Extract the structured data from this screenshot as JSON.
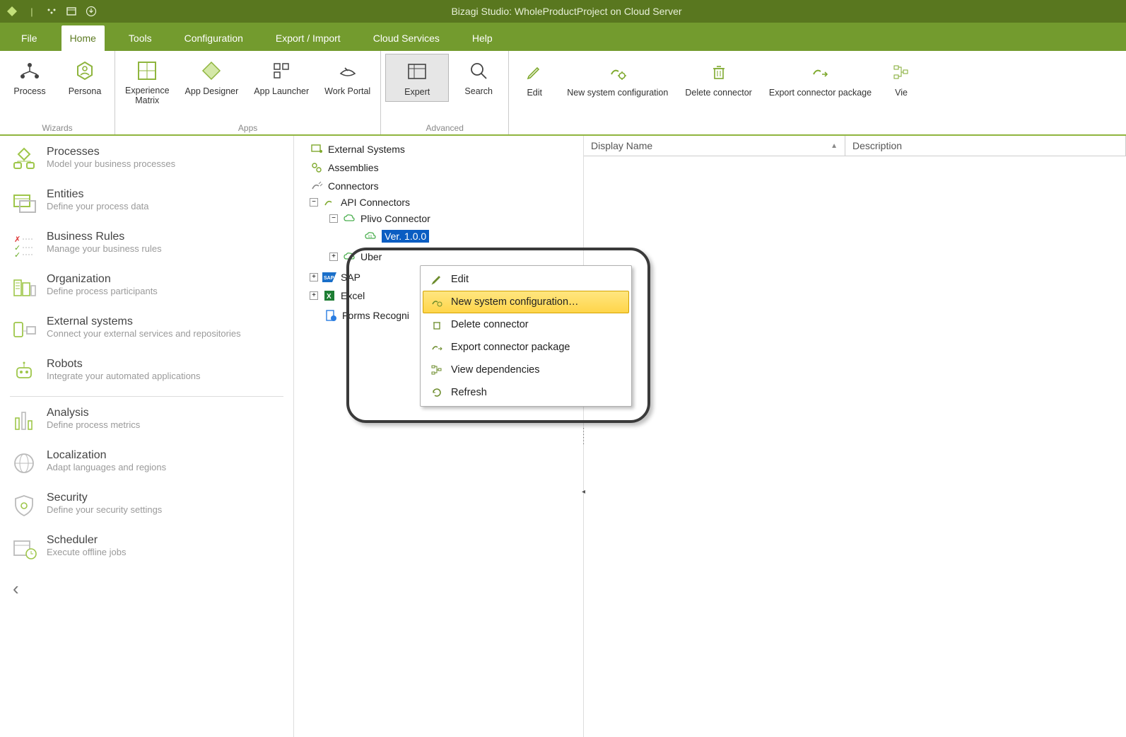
{
  "titlebar": {
    "title": "Bizagi Studio: WholeProductProject  on Cloud Server"
  },
  "tabs": {
    "file": "File",
    "home": "Home",
    "tools": "Tools",
    "configuration": "Configuration",
    "export_import": "Export / Import",
    "cloud_services": "Cloud Services",
    "help": "Help"
  },
  "ribbon": {
    "groups": {
      "wizards": {
        "label": "Wizards",
        "process": "Process",
        "persona": "Persona"
      },
      "apps": {
        "label": "Apps",
        "experience_matrix": "Experience Matrix",
        "app_designer": "App Designer",
        "app_launcher": "App Launcher",
        "work_portal": "Work Portal"
      },
      "advanced": {
        "label": "Advanced",
        "expert": "Expert",
        "search": "Search"
      }
    },
    "right": {
      "edit": "Edit",
      "new_system_configuration": "New system configuration",
      "delete_connector": "Delete connector",
      "export_connector_package": "Export connector package",
      "view_cut": "Vie"
    }
  },
  "sidebar": {
    "items": [
      {
        "title": "Processes",
        "subtitle": "Model your business processes"
      },
      {
        "title": "Entities",
        "subtitle": "Define your process data"
      },
      {
        "title": "Business  Rules",
        "subtitle": "Manage your business rules"
      },
      {
        "title": "Organization",
        "subtitle": "Define process participants"
      },
      {
        "title": "External systems",
        "subtitle": "Connect your external services and repositories"
      },
      {
        "title": "Robots",
        "subtitle": "Integrate your automated applications"
      },
      {
        "title": "Analysis",
        "subtitle": "Define process metrics"
      },
      {
        "title": "Localization",
        "subtitle": "Adapt languages and regions"
      },
      {
        "title": "Security",
        "subtitle": "Define your security settings"
      },
      {
        "title": "Scheduler",
        "subtitle": "Execute offline jobs"
      }
    ]
  },
  "tree": {
    "external_systems": "External Systems",
    "assemblies": "Assemblies",
    "connectors": "Connectors",
    "api_connectors": "API Connectors",
    "plivo_connector": "Plivo Connector",
    "version": "Ver. 1.0.0",
    "uber": "Uber",
    "sap": "SAP",
    "excel": "Excel",
    "forms_recognizer": "Forms Recogni"
  },
  "context_menu": {
    "edit": "Edit",
    "new_system_configuration": "New system configuration…",
    "delete_connector": "Delete connector",
    "export_connector_package": "Export connector package",
    "view_dependencies": "View dependencies",
    "refresh": "Refresh"
  },
  "columns": {
    "display_name": "Display Name",
    "description": "Description"
  }
}
